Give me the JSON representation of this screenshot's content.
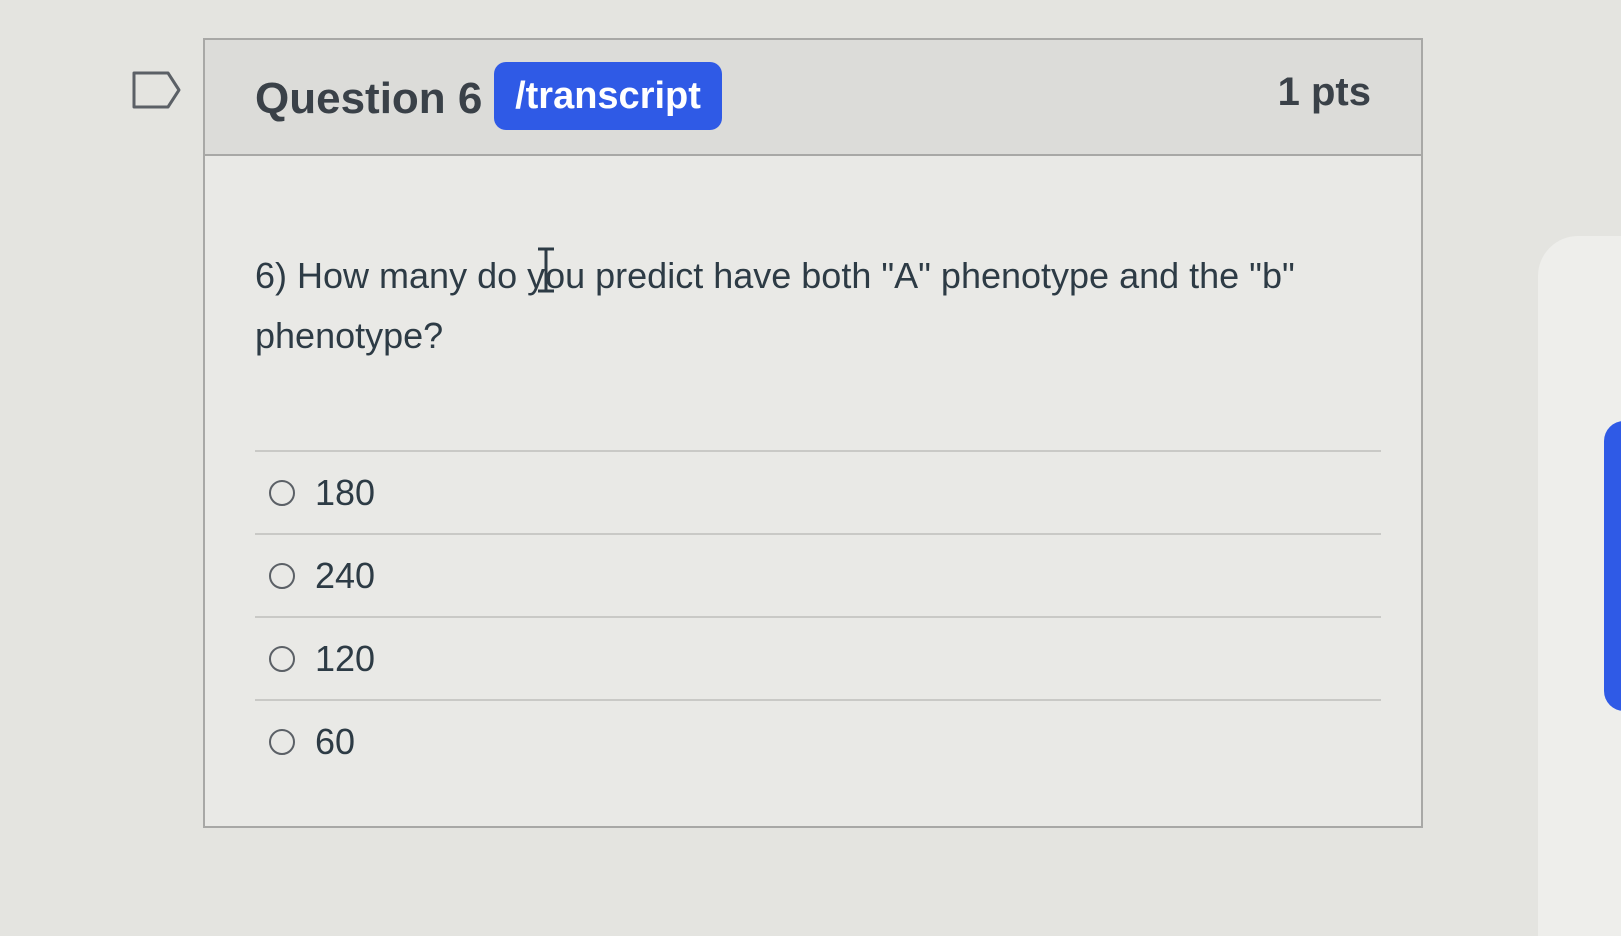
{
  "question": {
    "title": "Question 6",
    "badge": "/transcript",
    "points": "1 pts",
    "text": "6) How many do you predict have both \"A\" phenotype and the \"b\" phenotype?",
    "answers": [
      {
        "label": "180"
      },
      {
        "label": "240"
      },
      {
        "label": "120"
      },
      {
        "label": "60"
      }
    ]
  },
  "icons": {
    "bookmark": "bookmark-flag-icon",
    "cursor": "text-cursor-icon"
  },
  "colors": {
    "accent": "#2f5ae6",
    "text": "#2d3b45",
    "background": "#e4e4e0"
  }
}
